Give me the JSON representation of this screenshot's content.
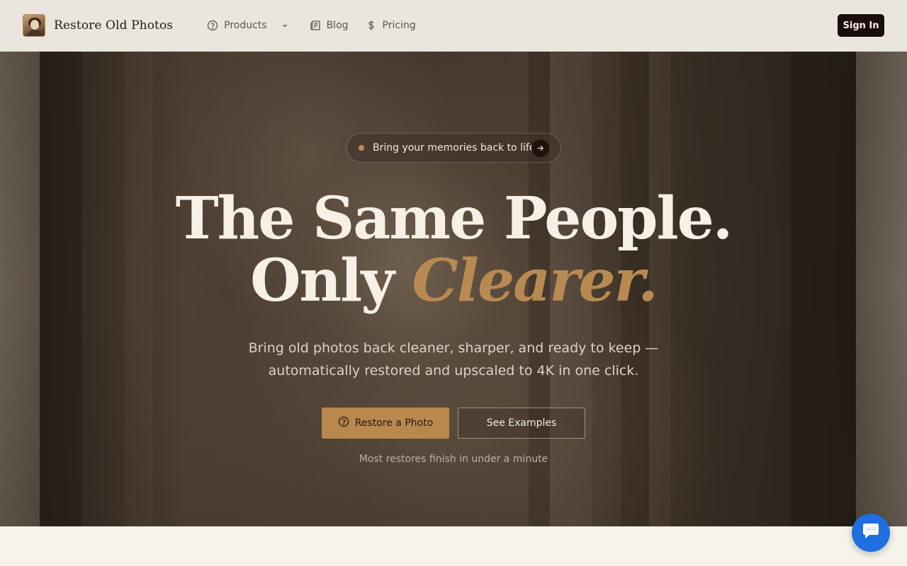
{
  "brand": {
    "name": "Restore Old Photos"
  },
  "nav": {
    "items": [
      {
        "label": "Products",
        "icon": "help-circle-icon",
        "has_dropdown": true
      },
      {
        "label": "Blog",
        "icon": "newspaper-icon"
      },
      {
        "label": "Pricing",
        "icon": "dollar-icon"
      }
    ]
  },
  "header": {
    "signin_label": "Sign In"
  },
  "hero": {
    "pill_text": "Bring your memories back to life",
    "headline_line1": "The Same People.",
    "headline_line2_plain": "Only",
    "headline_line2_accent": "Clearer.",
    "subtitle": "Bring old photos back cleaner, sharper, and ready to keep — automatically restored and upscaled to 4K in one click.",
    "primary_button": "Restore a Photo",
    "secondary_button": "See Examples",
    "note": "Most restores finish in under a minute"
  },
  "colors": {
    "accent": "#b88a52",
    "header_bg": "#eae6de",
    "signin_bg": "#1b0d0b",
    "chat_bubble": "#1f6fe0"
  }
}
